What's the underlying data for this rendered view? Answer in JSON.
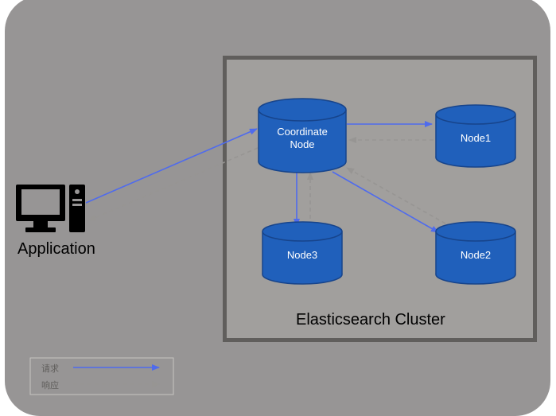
{
  "diagram": {
    "application_label": "Application",
    "cluster_title": "Elasticsearch Cluster",
    "nodes": {
      "coordinate": "Coordinate\nNode",
      "node1": "Node1",
      "node2": "Node2",
      "node3": "Node3"
    },
    "legend": {
      "request": "请求",
      "response": "响应"
    },
    "colors": {
      "node_fill": "#2060bb",
      "node_stroke": "#17448b",
      "arrow_request": "#4f6bed",
      "arrow_response": "#979593",
      "cluster_border": "#605e5c",
      "cluster_fill": "#a19f9d",
      "canvas_fill": "#979595"
    },
    "connections": [
      {
        "from": "Application",
        "to": "Coordinate Node",
        "type": "request"
      },
      {
        "from": "Coordinate Node",
        "to": "Application",
        "type": "response"
      },
      {
        "from": "Coordinate Node",
        "to": "Node1",
        "type": "request"
      },
      {
        "from": "Node1",
        "to": "Coordinate Node",
        "type": "response"
      },
      {
        "from": "Coordinate Node",
        "to": "Node2",
        "type": "request"
      },
      {
        "from": "Node2",
        "to": "Coordinate Node",
        "type": "response"
      },
      {
        "from": "Coordinate Node",
        "to": "Node3",
        "type": "request"
      },
      {
        "from": "Node3",
        "to": "Coordinate Node",
        "type": "response"
      }
    ]
  }
}
